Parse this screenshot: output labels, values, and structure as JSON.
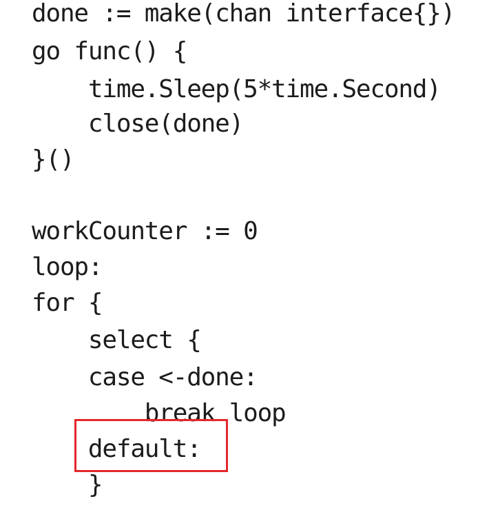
{
  "code": {
    "lines": [
      "done := make(chan interface{})",
      "go func() {",
      "    time.Sleep(5*time.Second)",
      "    close(done)",
      "}()",
      "",
      "workCounter := 0",
      "loop:",
      "for {",
      "    select {",
      "    case <-done:",
      "        break loop",
      "    default:",
      "    }"
    ]
  },
  "highlight": {
    "color": "#e3262b",
    "target_text": "default:"
  }
}
